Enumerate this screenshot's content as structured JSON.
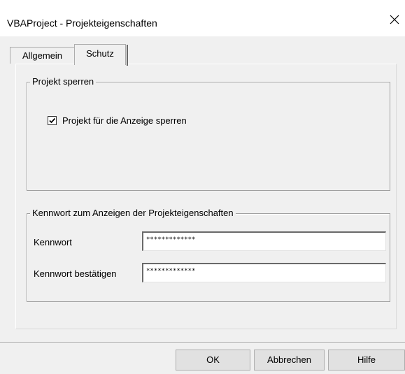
{
  "window": {
    "title": "VBAProject - Projekteigenschaften",
    "close_icon": "close-icon"
  },
  "tabs": [
    {
      "label": "Allgemein",
      "selected": false
    },
    {
      "label": "Schutz",
      "selected": true
    }
  ],
  "lock_group": {
    "legend": "Projekt sperren",
    "checkbox_label": "Projekt für die Anzeige sperren",
    "checked": true
  },
  "password_group": {
    "legend": "Kennwort zum Anzeigen der Projekteigenschaften",
    "password_label": "Kennwort",
    "password_value": "*************",
    "confirm_label": "Kennwort bestätigen",
    "confirm_value": "*************"
  },
  "buttons": {
    "ok": "OK",
    "cancel": "Abbrechen",
    "help": "Hilfe"
  }
}
